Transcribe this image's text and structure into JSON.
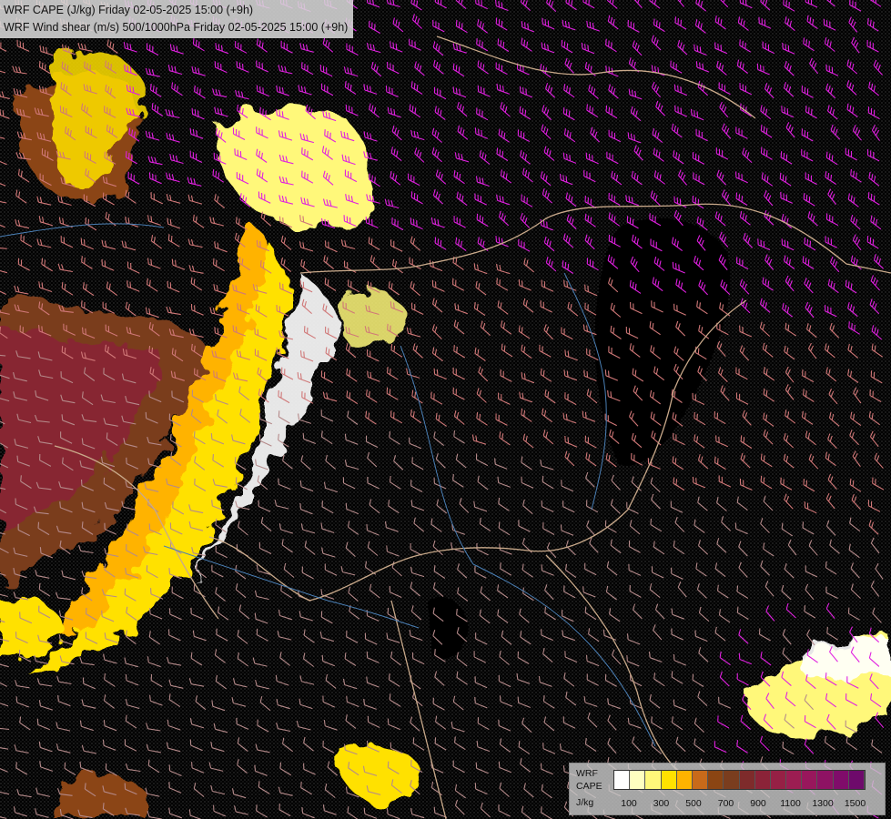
{
  "title": {
    "line1": "WRF CAPE (J/kg) Friday 02-05-2025 15:00 (+9h)",
    "line2": "WRF Wind shear (m/s) 500/1000hPa Friday 02-05-2025 15:00 (+9h)"
  },
  "legend": {
    "label_line1": "WRF",
    "label_line2": "CAPE",
    "label_line3": "J/kg",
    "colors": [
      "#ffffff",
      "#ffffc0",
      "#fff87a",
      "#ffe100",
      "#ffb300",
      "#c86a1a",
      "#8b4513",
      "#7a3d1e",
      "#7e2b2b",
      "#8b2338",
      "#962045",
      "#9c1d52",
      "#98175c",
      "#8e1263",
      "#800c6a",
      "#6e0a6b"
    ],
    "ticks": [
      "100",
      "300",
      "500",
      "700",
      "900",
      "1100",
      "1300",
      "1500"
    ]
  },
  "map_colors": {
    "background": "#000000",
    "border_lines": "#c9a98a",
    "rivers": "#4a7fb5",
    "barb_low": "#b58a8a",
    "barb_mid": "#d07878",
    "barb_high": "#e020e0"
  }
}
